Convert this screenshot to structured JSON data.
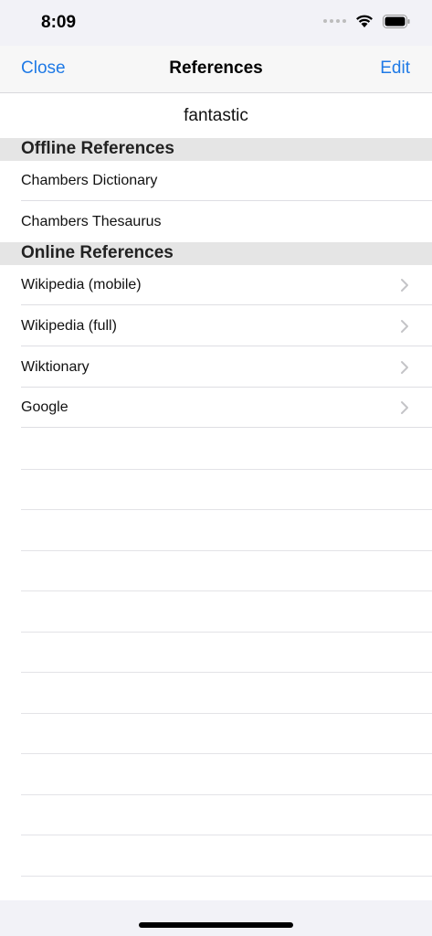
{
  "status": {
    "time": "8:09"
  },
  "nav": {
    "left": "Close",
    "title": "References",
    "right": "Edit"
  },
  "word": "fantastic",
  "sections": [
    {
      "title": "Offline References",
      "items": [
        "Chambers Dictionary",
        "Chambers Thesaurus"
      ]
    },
    {
      "title": "Online References",
      "items": [
        "Wikipedia (mobile)",
        "Wikipedia (full)",
        "Wiktionary",
        "Google"
      ]
    }
  ],
  "colors": {
    "accent": "#1f7ae6",
    "section_bg": "#e5e5e5",
    "bar_bg": "#f7f7f7"
  },
  "icons": {
    "row_accessory": "chevron-right-icon"
  }
}
